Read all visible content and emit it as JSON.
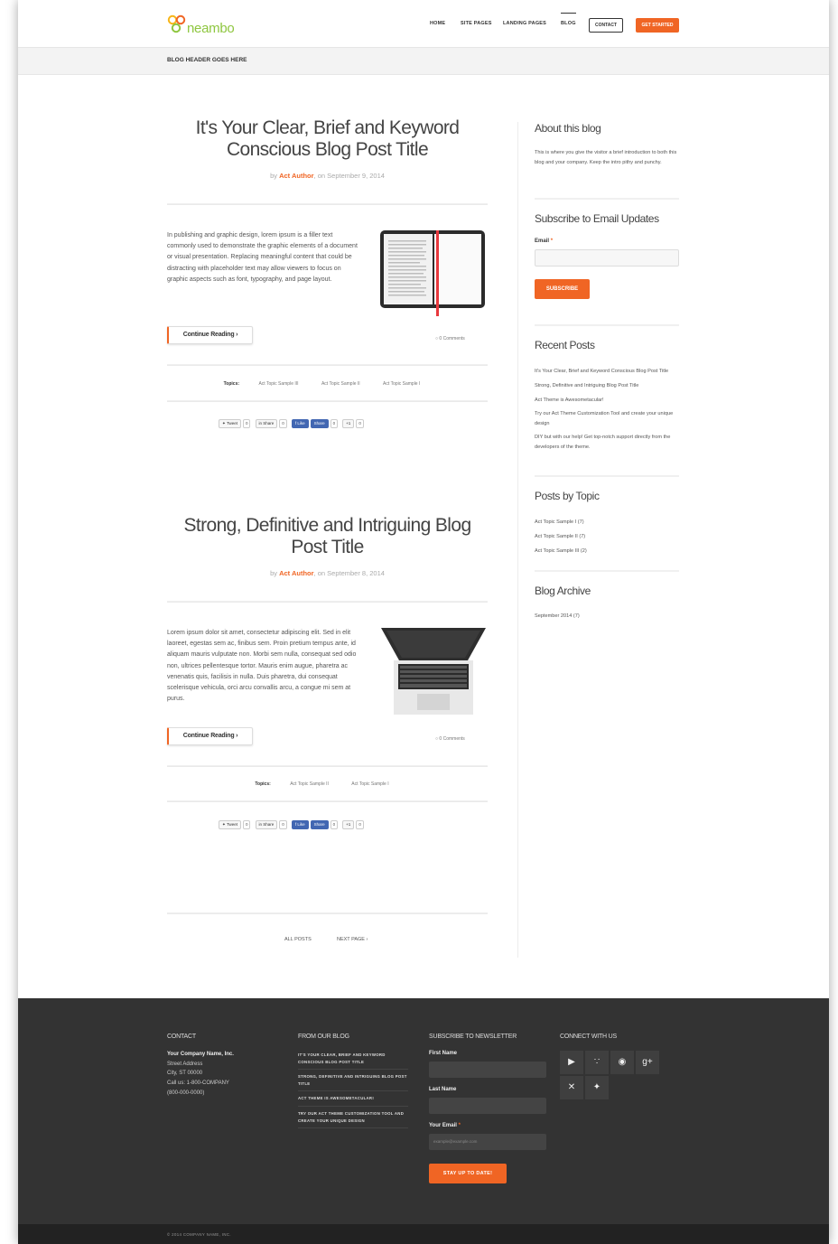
{
  "brand": {
    "logo_text": "neambo",
    "accent": "#f06524",
    "logo_green": "#8ec63f"
  },
  "nav": {
    "items": [
      "HOME",
      "SITE PAGES",
      "LANDING PAGES",
      "BLOG"
    ],
    "contact": "CONTACT",
    "cta": "GET STARTED"
  },
  "blog_header": "BLOG HEADER GOES HERE",
  "posts": [
    {
      "title_line1": "It's Your Clear, Brief and Keyword",
      "title_line2": "Conscious Blog Post Title",
      "by": "by",
      "author": "Act Author",
      "date": ", on September 9, 2014",
      "excerpt": "In publishing and graphic design, lorem ipsum is a filler text commonly used to demonstrate the graphic elements of a document or visual presentation. Replacing meaningful content that could be distracting with placeholder text may allow viewers to focus on graphic aspects such as font, typography, and page layout.",
      "continue": "Continue Reading ›",
      "comments": "0 Comments",
      "topics_label": "Topics:",
      "topics": [
        "Act Topic Sample III",
        "Act Topic Sample II",
        "Act Topic Sample I"
      ]
    },
    {
      "title_line1": "Strong, Definitive and Intriguing Blog",
      "title_line2": "Post Title",
      "by": "by",
      "author": "Act Author",
      "date": ", on September 8, 2014",
      "excerpt": "Lorem ipsum dolor sit amet, consectetur adipiscing elit. Sed in elit laoreet, egestas sem ac, finibus sem. Proin pretium tempus ante, id aliquam mauris vulputate non. Morbi sem nulla, consequat sed odio non, ultrices pellentesque tortor. Mauris enim augue, pharetra ac venenatis quis, facilisis in nulla. Duis pharetra, dui consequat scelerisque vehicula, orci arcu convallis arcu, a congue mi sem at purus.",
      "continue": "Continue Reading ›",
      "comments": "0 Comments",
      "topics_label": "Topics:",
      "topics": [
        "Act Topic Sample II",
        "Act Topic Sample I"
      ]
    }
  ],
  "share": {
    "tweet": "Tweet",
    "tweet_count": "0",
    "linkedin": "Share",
    "linkedin_count": "0",
    "like": "Like",
    "fb_share": "Share",
    "fb_count": "0",
    "gplus": "+1",
    "gplus_count": "0"
  },
  "pagination": {
    "all": "ALL POSTS",
    "next": "NEXT PAGE  ›"
  },
  "sidebar": {
    "about_title": "About this blog",
    "about_text": "This is where you give the visitor a brief introduction to both this blog and your company. Keep the intro pithy and punchy.",
    "subscribe_title": "Subscribe to Email Updates",
    "email_label": "Email",
    "subscribe_button": "SUBSCRIBE",
    "recent_title": "Recent Posts",
    "recent": [
      "It's Your Clear, Brief and Keyword Conscious Blog Post Title",
      "Strong, Definitive and Intriguing Blog Post Title",
      "Act Theme is Awesometacular!",
      "Try our Act Theme Customization Tool and create your unique design",
      "DIY but with our help! Get top-notch support directly from the developers of the theme."
    ],
    "topics_title": "Posts by Topic",
    "topics": [
      "Act Topic Sample I (7)",
      "Act Topic Sample II (7)",
      "Act Topic Sample III (2)"
    ],
    "archive_title": "Blog Archive",
    "archive": [
      "September 2014 (7)"
    ]
  },
  "footer": {
    "contact_title": "CONTACT",
    "company": "Your Company Name, Inc.",
    "address": "Street Address",
    "city": "City, ST 00000",
    "phone": "Call us: 1-800-COMPANY",
    "phone2": "(800-000-0000)",
    "blog_title": "FROM OUR BLOG",
    "blog_items": [
      "IT'S YOUR CLEAR, BRIEF AND KEYWORD CONSCIOUS BLOG POST TITLE",
      "STRONG, DEFINITIVE AND INTRIGUING BLOG POST TITLE",
      "ACT THEME IS AWESOMETACULAR!",
      "TRY OUR ACT THEME CUSTOMIZATION TOOL AND CREATE YOUR UNIQUE DESIGN"
    ],
    "newsletter_title": "SUBSCRIBE TO NEWSLETTER",
    "first_name": "First Name",
    "last_name": "Last Name",
    "your_email": "Your Email",
    "email_placeholder": "example@example.com",
    "newsletter_button": "STAY UP TO DATE!",
    "connect_title": "CONNECT WITH US",
    "social_icons": [
      "youtube-icon",
      "rss-icon",
      "pinterest-icon",
      "google-plus-icon",
      "xing-icon",
      "twitter-icon"
    ],
    "copyright": "© 2014 COMPANY NAME, INC."
  }
}
